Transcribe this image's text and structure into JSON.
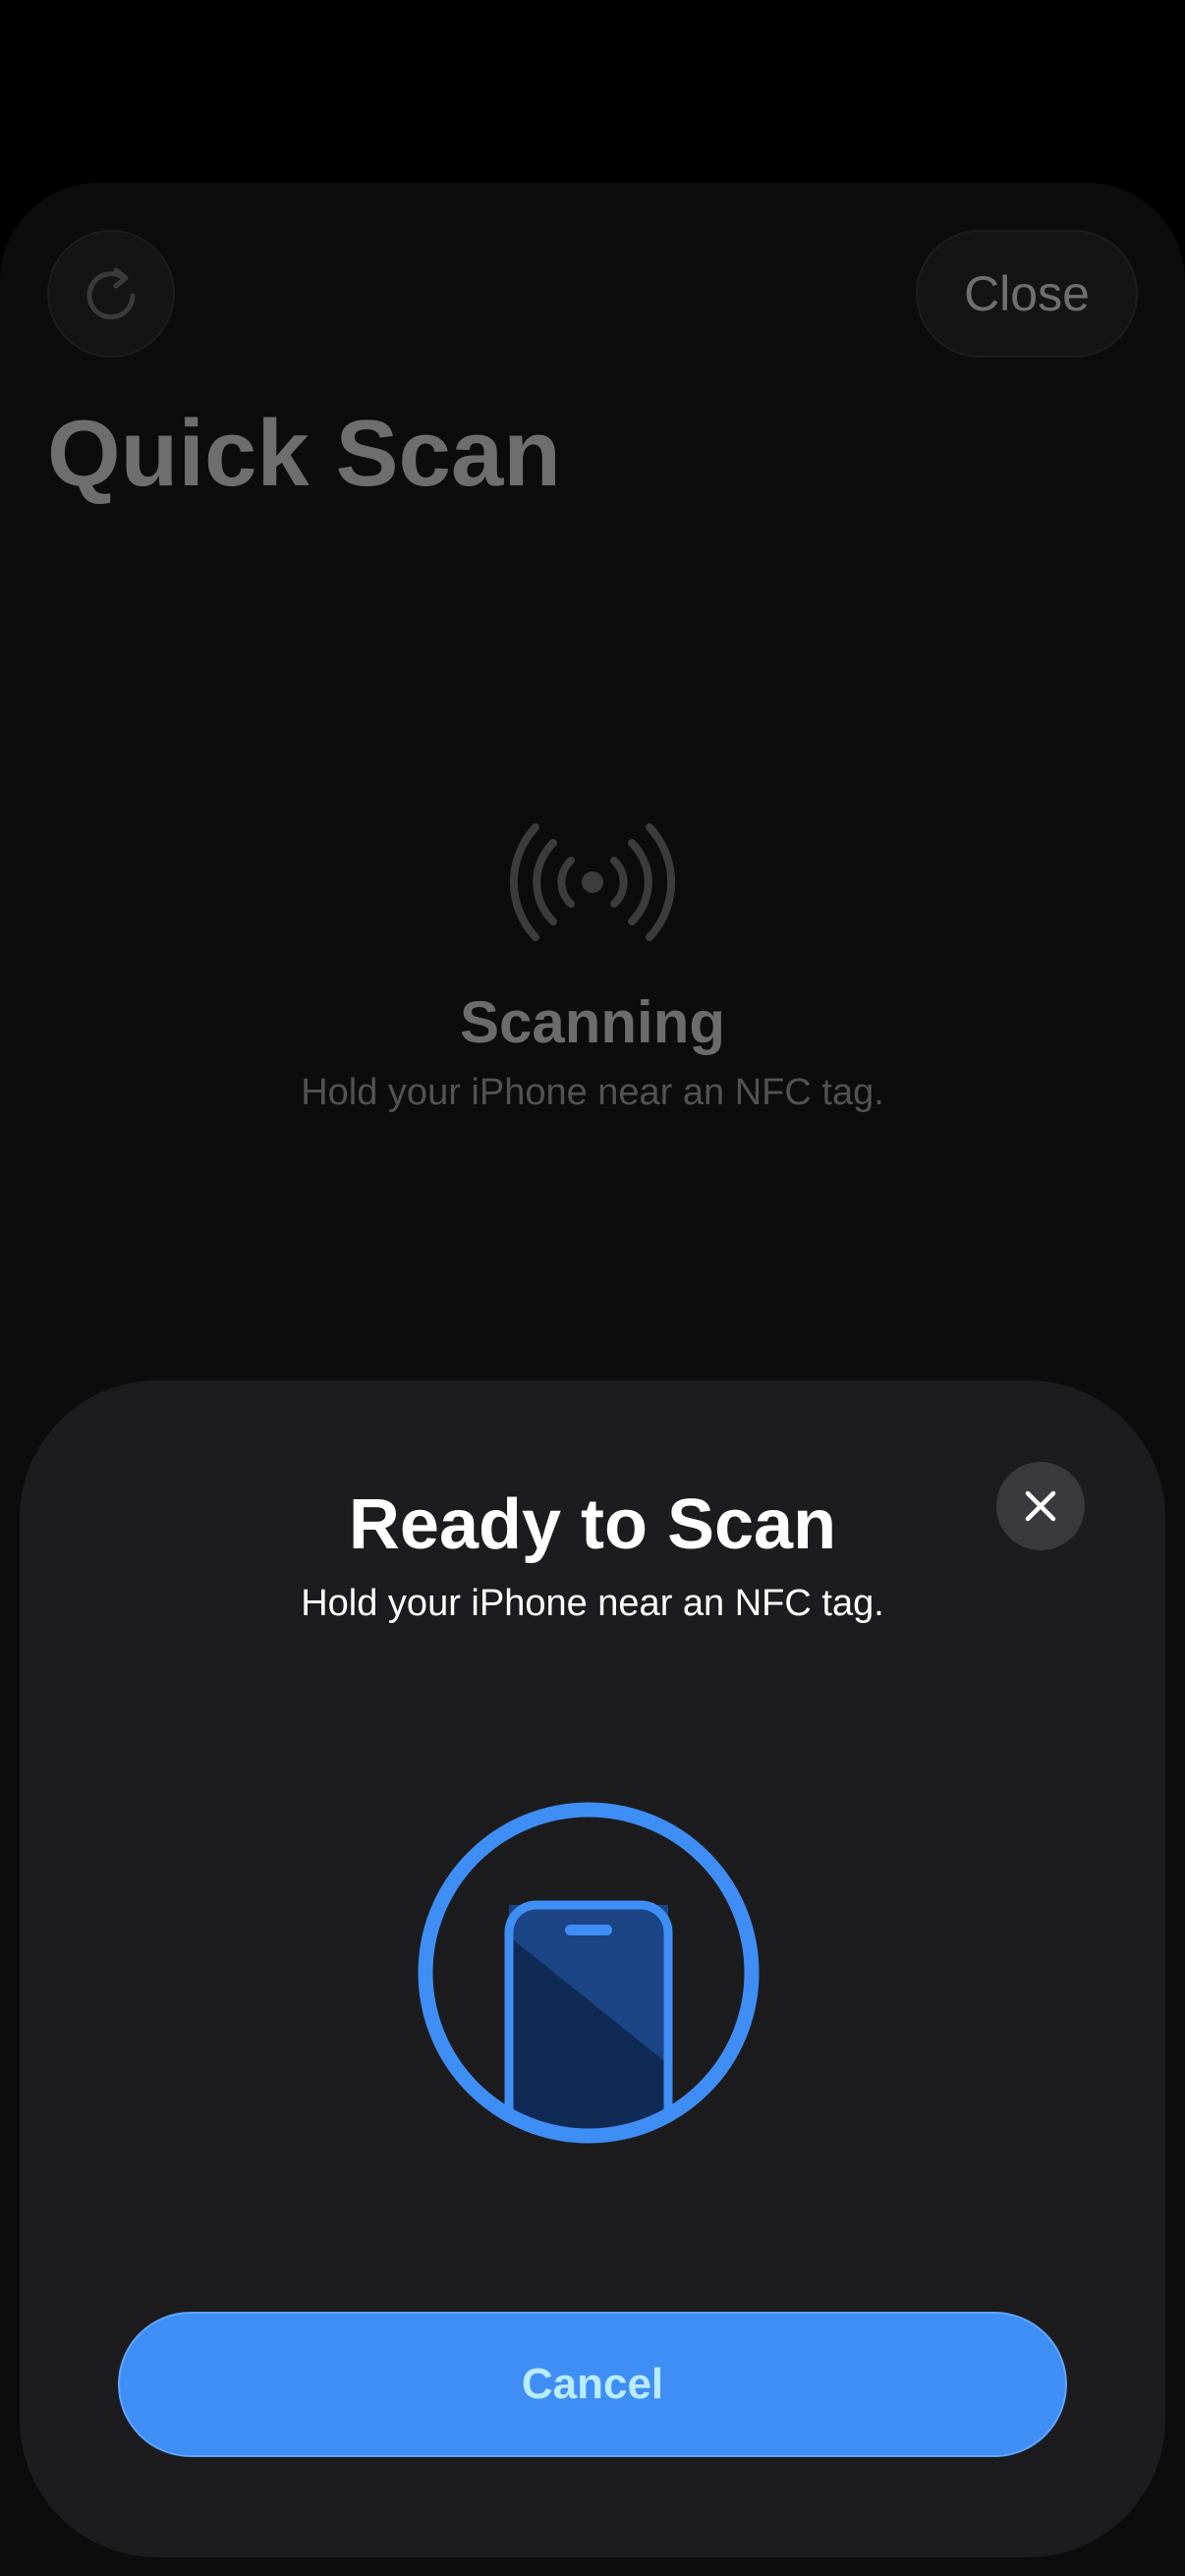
{
  "background": {
    "refresh_icon": "arrow-clockwise-icon",
    "close_label": "Close",
    "title": "Quick Scan",
    "status_icon": "nfc-waves-icon",
    "status_title": "Scanning",
    "status_subtitle": "Hold your iPhone near an NFC tag."
  },
  "nfc_sheet": {
    "title": "Ready to Scan",
    "subtitle": "Hold your iPhone near an NFC tag.",
    "close_icon": "xmark-icon",
    "graphic_icon": "iphone-icon",
    "cancel_label": "Cancel"
  },
  "colors": {
    "accent": "#3f8ef5",
    "sheet_background": "#1c1c1e",
    "cancel_text": "#b9ecff"
  }
}
